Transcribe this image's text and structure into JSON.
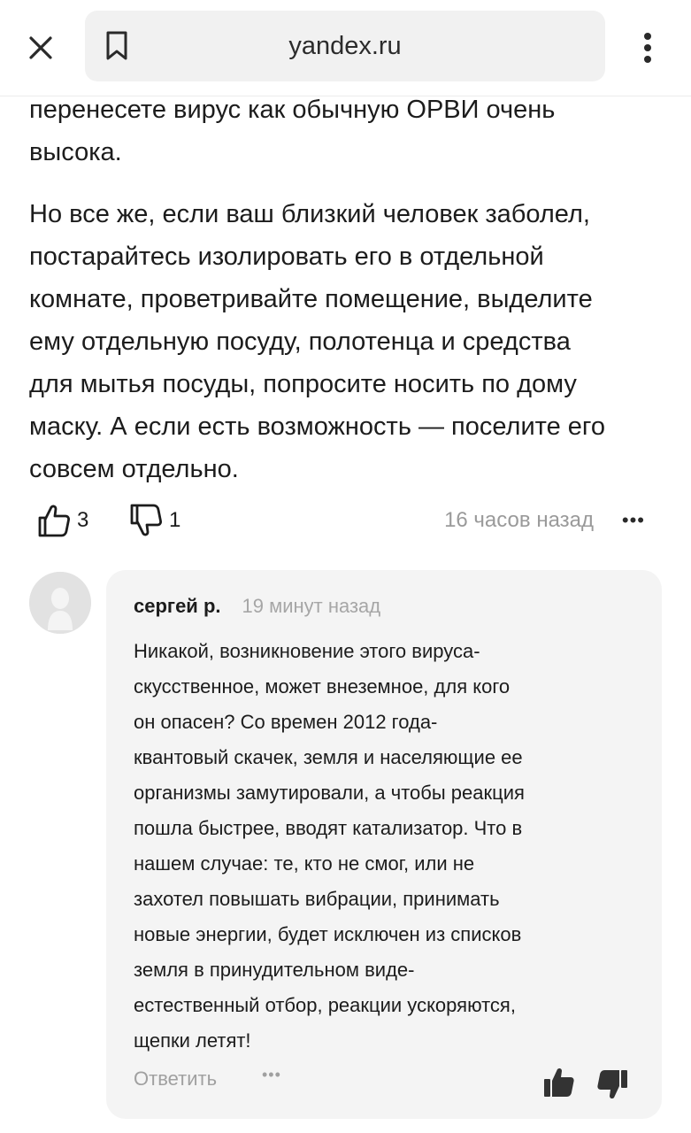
{
  "browser": {
    "url": "yandex.ru"
  },
  "article": {
    "paragraphs": [
      "перенесете вирус как обычную ОРВИ очень\nвысока.",
      "Но все же, если ваш близкий человек заболел,\nпостарайтесь изолировать его в отдельной\nкомнате, проветривайте помещение, выделите\nему отдельную посуду, полотенца и средства\nдля мытья посуды, попросите носить по дому\nмаску. А если есть возможность — поселите его\nсовсем отдельно."
    ]
  },
  "reactions": {
    "likes": "3",
    "dislikes": "1",
    "time": "16 часов назад",
    "more": "•••"
  },
  "comment": {
    "author": "сергей р.",
    "time": "19 минут назад",
    "text": "Никакой, возникновение этого вируса-\nскусственное, может внеземное, для кого\nон опасен? Со времен 2012 года-\nквантовый скачек, земля и населяющие ее\nорганизмы замутировали, а чтобы реакция\nпошла быстрее, вводят катализатор. Что в\nнашем случае: те, кто не смог, или не\nзахотел повышать вибрации, принимать\nновые энергии, будет исключен из списков\nземля в принудительном виде-\nестественный отбор, реакции ускоряются,\nщепки летят!",
    "reply_label": "Ответить",
    "more": "•••"
  },
  "icons": {
    "close": "close-icon",
    "bookmark": "bookmark-icon",
    "menu": "kebab-menu-icon",
    "like": "thumbs-up-icon",
    "dislike": "thumbs-down-icon",
    "avatar": "user-avatar-icon"
  },
  "colors": {
    "comment_background": "#f4f4f4",
    "url_bar_background": "#f1f1f1",
    "muted_text": "#9a9a9a"
  }
}
